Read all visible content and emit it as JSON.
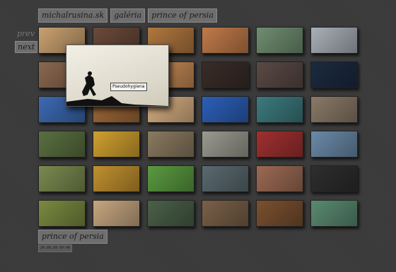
{
  "breadcrumbs": [
    "michalrusina.sk",
    "galéria",
    "prince of persia"
  ],
  "nav": {
    "prev_label": "prev",
    "next_label": "next"
  },
  "thumbs": [
    "#c9a170",
    "#6a4a3a",
    "#b07840",
    "#c07a4a",
    "#6f8e70",
    "#a9b0b8",
    "#8a6850",
    "#2a2a30",
    "#c58a55",
    "#3a2c28",
    "#5a4a45",
    "#1c2a40",
    "#3c6ab2",
    "#a26a38",
    "#d7b083",
    "#2c5fb8",
    "#3c7a7e",
    "#8a7a68",
    "#5a7040",
    "#d0a030",
    "#8a7a60",
    "#9a9a90",
    "#a03030",
    "#6a8aa8",
    "#7a8a50",
    "#c09030",
    "#5a9a40",
    "#5a6a70",
    "#9c6a54",
    "#2e2e2e",
    "#7a8a40",
    "#c6a680",
    "#4a6048",
    "#7a6048",
    "#7a5030",
    "#5a8a70"
  ],
  "popup": {
    "tooltip": "Pseudohygiena"
  },
  "album_title": "prince of persia",
  "date": "24.08.09 09:40"
}
